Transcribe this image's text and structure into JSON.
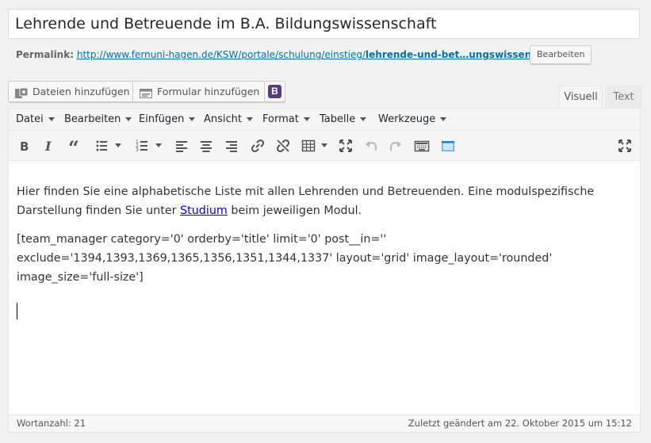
{
  "post": {
    "title": "Lehrende und Betreuende im B.A. Bildungswissenschaft"
  },
  "permalink": {
    "label": "Permalink:",
    "url_prefix": "http://www.fernuni-hagen.de/KSW/portale/schulung/einstieg/",
    "url_slug": "lehrende-und-bet…ungswissenschaft",
    "url_suffix": "/",
    "edit_label": "Bearbeiten"
  },
  "media_buttons": {
    "add_media": "Dateien hinzufügen",
    "add_form": "Formular hinzufügen",
    "bootstrap": "B"
  },
  "editor_tabs": {
    "visual": "Visuell",
    "text": "Text"
  },
  "menubar": [
    "Datei",
    "Bearbeiten",
    "Einfügen",
    "Ansicht",
    "Format",
    "Tabelle",
    "Werkzeuge"
  ],
  "toolbar_icons": [
    "bold-icon",
    "italic-icon",
    "blockquote-icon",
    "bullet-list-icon",
    "numbered-list-icon",
    "align-left-icon",
    "align-center-icon",
    "align-right-icon",
    "link-icon",
    "unlink-icon",
    "table-icon",
    "fullscreen-icon",
    "undo-icon",
    "redo-icon",
    "keyboard-shortcuts-icon",
    "page-layout-icon",
    "expand-icon"
  ],
  "content": {
    "para1_before": "Hier finden Sie eine alphabetische Liste mit allen Lehrenden und Betreuenden. Eine modulspezifische Darstellung finden Sie unter ",
    "para1_link": "Studium",
    "para1_after": " beim jeweiligen Modul.",
    "shortcode": "[team_manager category='0' orderby='title' limit='0' post__in='' exclude='1394,1393,1369,1365,1356,1351,1344,1337' layout='grid' image_layout='rounded' image_size='full-size']"
  },
  "status": {
    "word_count": "Wortanzahl: 21",
    "last_modified": "Zuletzt geändert am 22. Oktober 2015 um 15:12"
  },
  "colors": {
    "link": "#0073aa",
    "bootstrap_purple": "#563d7c",
    "content_link": "#0000ee"
  }
}
